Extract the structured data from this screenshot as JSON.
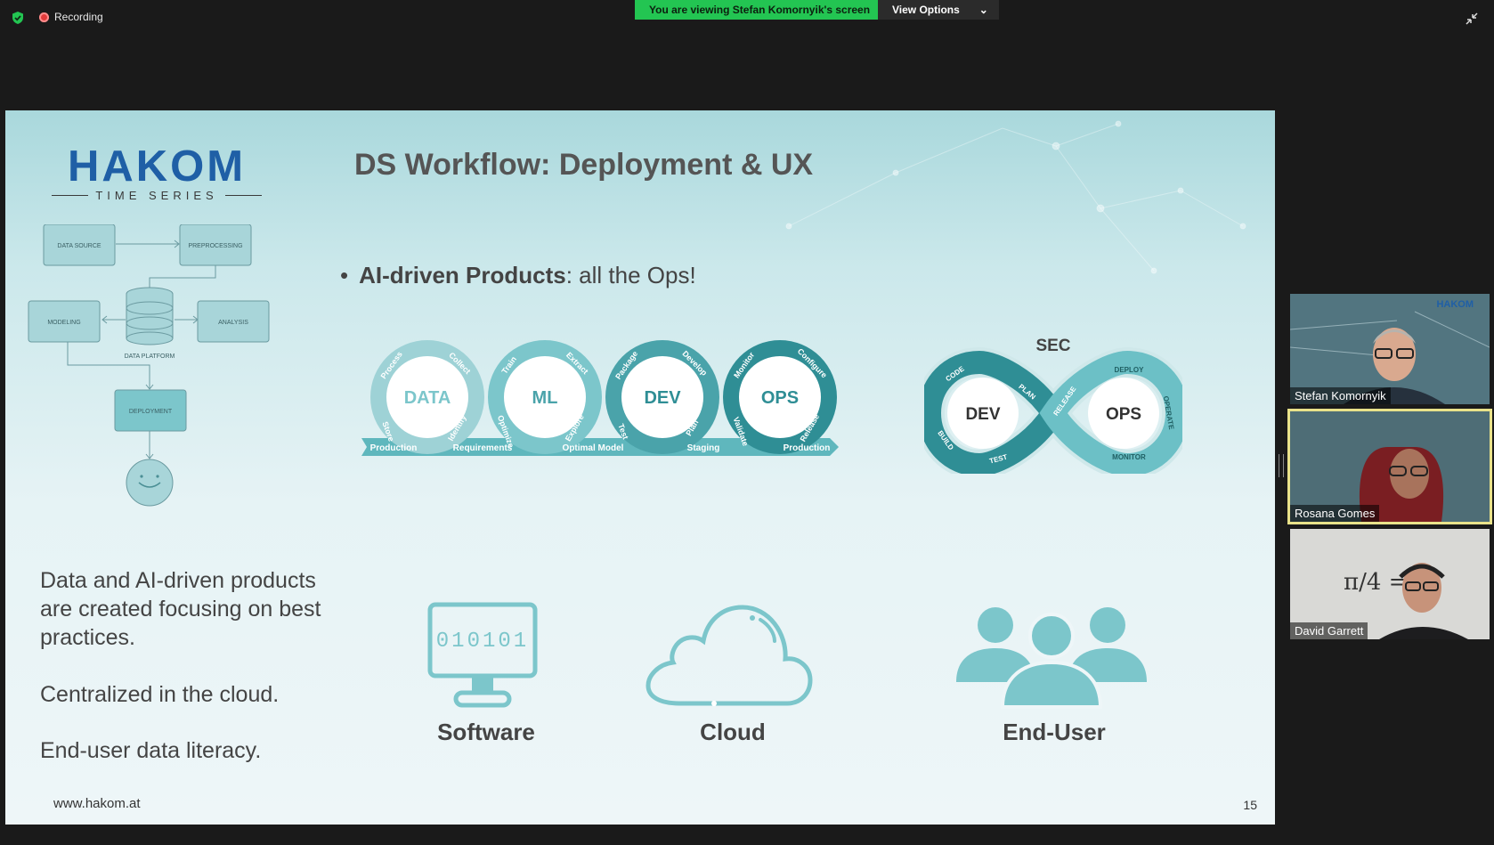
{
  "topbar": {
    "recording_label": "Recording",
    "viewing_banner": "You are viewing Stefan Komornyik's screen",
    "view_options_label": "View Options",
    "view_options_chevron": "⌄"
  },
  "slide": {
    "logo_word": "HAKOM",
    "logo_sub": "TIME SERIES",
    "title": "DS Workflow: Deployment & UX",
    "bullet_bold": "AI-driven Products",
    "bullet_rest": ": all the Ops!",
    "flow": {
      "data_source": "DATA SOURCE",
      "preprocessing": "PREPROCESSING",
      "modeling": "MODELING",
      "analysis": "ANALYSIS",
      "data_platform": "DATA PLATFORM",
      "deployment": "DEPLOYMENT"
    },
    "wheels": [
      {
        "label": "DATA",
        "arc_top": "Process",
        "arc_top2": "Collect",
        "arc_bottom": "Store",
        "arc_bottom2": "Identify"
      },
      {
        "label": "ML",
        "arc_top": "Train",
        "arc_top2": "Extract",
        "arc_bottom": "Optimize",
        "arc_bottom2": "Explore"
      },
      {
        "label": "DEV",
        "arc_top": "Package",
        "arc_top2": "Develop",
        "arc_bottom": "Test",
        "arc_bottom2": "Plan"
      },
      {
        "label": "OPS",
        "arc_top": "Monitor",
        "arc_top2": "Configure",
        "arc_bottom": "Validate",
        "arc_bottom2": "Release"
      }
    ],
    "stages": [
      "Production",
      "Requirements",
      "Optimal Model",
      "Staging",
      "Production"
    ],
    "devsecops": {
      "sec": "SEC",
      "dev": "DEV",
      "ops": "OPS",
      "code": "CODE",
      "plan": "PLAN",
      "build": "BUILD",
      "test": "TEST",
      "release": "RELEASE",
      "deploy": "DEPLOY",
      "operate": "OPERATE",
      "monitor": "MONITOR"
    },
    "left_text": {
      "p1": "Data and AI-driven products are created focusing on best practices.",
      "p2": "Centralized in the cloud.",
      "p3": "End-user data literacy."
    },
    "icons": {
      "software_screen": "010101",
      "software_label": "Software",
      "cloud_label": "Cloud",
      "enduser_label": "End-User"
    },
    "footer_url": "www.hakom.at",
    "page_number": "15"
  },
  "participants": [
    {
      "name": "Stefan Komornyik",
      "tag": "HAKOM"
    },
    {
      "name": "Rosana Gomes"
    },
    {
      "name": "David Garrett",
      "board": "π/4 = Σ"
    }
  ],
  "colors": {
    "accent_teal": "#3f9aa0",
    "teal_light": "#7cc6cb",
    "banner_green": "#23c552",
    "brand_blue": "#1f5fa6"
  }
}
